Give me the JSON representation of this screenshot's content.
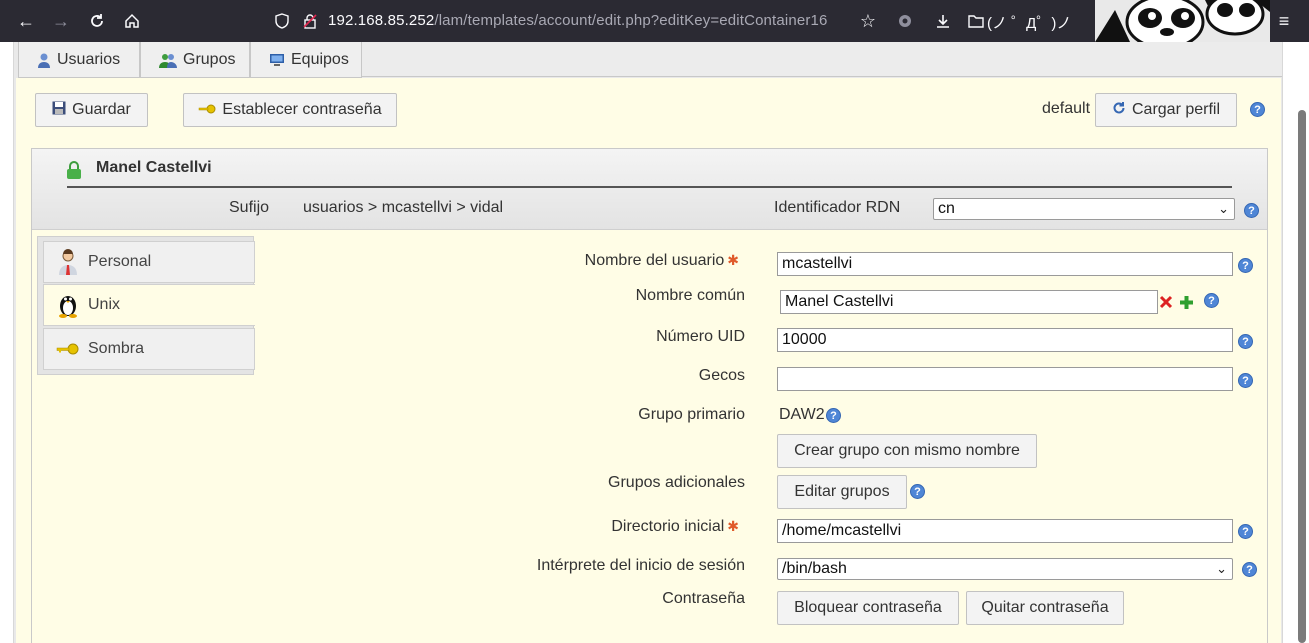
{
  "browser": {
    "url_host": "192.168.85.252",
    "url_path": "/lam/templates/account/edit.php?editKey=editContainer16",
    "bookmark_folder": "(ノ ゜Д゜)ノ"
  },
  "type_tabs": [
    {
      "label": "Usuarios",
      "icon": "user-icon"
    },
    {
      "label": "Grupos",
      "icon": "group-icon"
    },
    {
      "label": "Equipos",
      "icon": "computer-icon"
    }
  ],
  "toolbar": {
    "save_label": "Guardar",
    "set_password_label": "Establecer contraseña",
    "profile_name": "default",
    "load_profile_label": "Cargar perfil"
  },
  "account": {
    "title": "Manel Castellvi",
    "suffix_label": "Sufijo",
    "suffix_value": "usuarios > mcastellvi > vidal",
    "rdn_label": "Identificador RDN",
    "rdn_value": "cn"
  },
  "modules": [
    {
      "label": "Personal",
      "icon": "person-icon"
    },
    {
      "label": "Unix",
      "icon": "penguin-icon"
    },
    {
      "label": "Sombra",
      "icon": "key-icon"
    }
  ],
  "form": {
    "username_label": "Nombre del usuario",
    "username_value": "mcastellvi",
    "common_name_label": "Nombre común",
    "common_name_value": "Manel Castellvi",
    "uid_label": "Número UID",
    "uid_value": "10000",
    "gecos_label": "Gecos",
    "gecos_value": "",
    "primary_group_label": "Grupo primario",
    "primary_group_value": "DAW2",
    "create_group_label": "Crear grupo con mismo nombre",
    "additional_groups_label": "Grupos adicionales",
    "edit_groups_label": "Editar grupos",
    "home_dir_label": "Directorio inicial",
    "home_dir_value": "/home/mcastellvi",
    "shell_label": "Intérprete del inicio de sesión",
    "shell_value": "/bin/bash",
    "password_label": "Contraseña",
    "lock_password_label": "Bloquear contraseña",
    "remove_password_label": "Quitar contraseña"
  },
  "colors": {
    "accent_help": "#4f86d6",
    "form_background": "#fffde6",
    "required_marker": "#e05a2a"
  }
}
